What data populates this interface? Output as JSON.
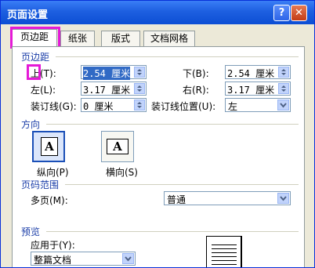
{
  "window": {
    "title": "页面设置"
  },
  "tabs": [
    {
      "label": "页边距"
    },
    {
      "label": "纸张"
    },
    {
      "label": "版式"
    },
    {
      "label": "文档网格"
    }
  ],
  "margins": {
    "group_title": "页边距",
    "top": {
      "label": "上(T):",
      "value": "2.54 厘米"
    },
    "bottom": {
      "label": "下(B):",
      "value": "2.54 厘米"
    },
    "left": {
      "label": "左(L):",
      "value": "3.17 厘米"
    },
    "right": {
      "label": "右(R):",
      "value": "3.17 厘米"
    },
    "gutter": {
      "label": "装订线(G):",
      "value": "0 厘米"
    },
    "gutter_position": {
      "label": "装订线位置(U):",
      "value": "左"
    }
  },
  "orientation": {
    "group_title": "方向",
    "portrait": {
      "label": "纵向(P)",
      "glyph": "A"
    },
    "landscape": {
      "label": "横向(S)",
      "glyph": "A"
    }
  },
  "pages": {
    "group_title": "页码范围",
    "multiple_label": "多页(M):",
    "multiple_value": "普通"
  },
  "preview": {
    "group_title": "预览",
    "apply_label": "应用于(Y):",
    "apply_value": "整篇文档"
  },
  "colors": {
    "titlebar": "#1d5fe0",
    "highlight": "#e51ad7",
    "group_text": "#1b3ea8"
  }
}
